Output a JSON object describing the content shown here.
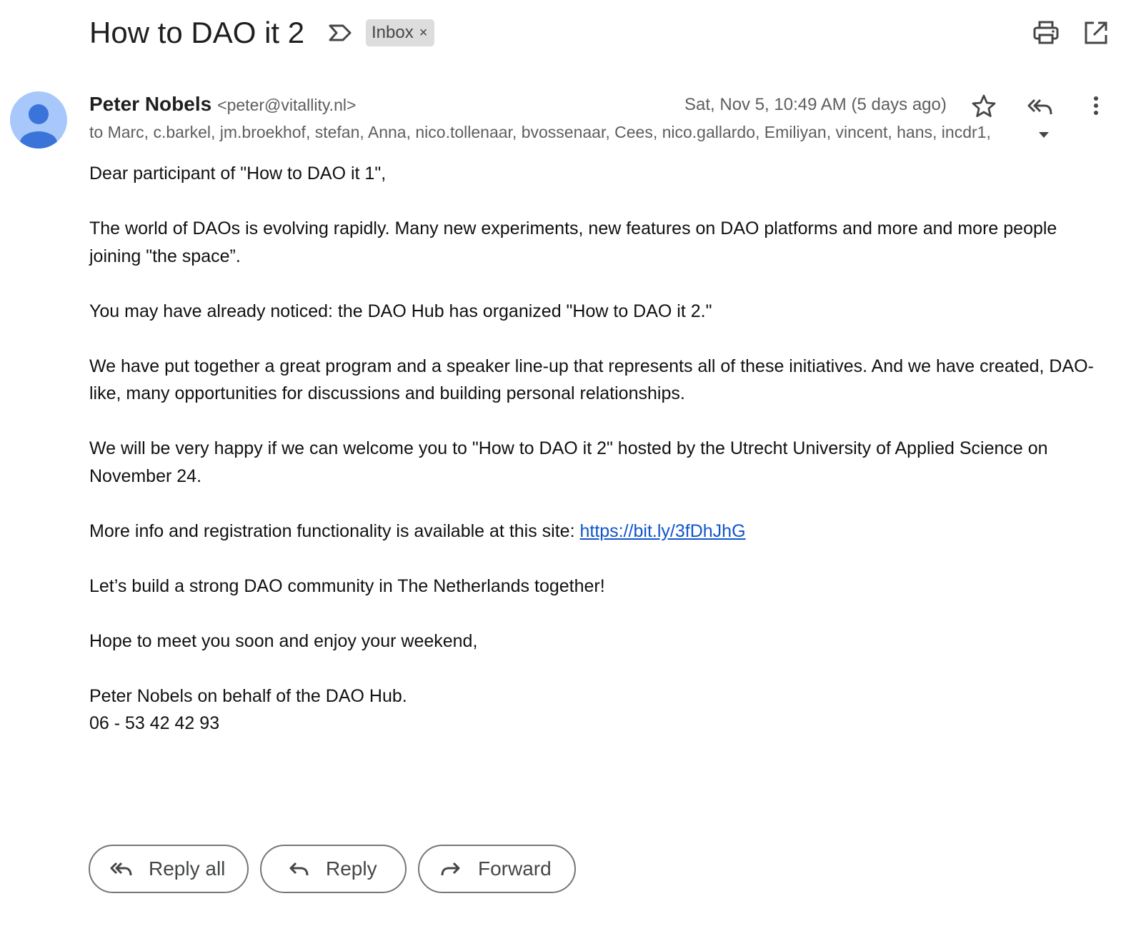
{
  "subject": "How to DAO it 2",
  "label": {
    "text": "Inbox",
    "remove_glyph": "×"
  },
  "icons": {
    "important": "important-marker-icon",
    "print": "print-icon",
    "popout": "open-in-new-window-icon",
    "star": "star-icon",
    "reply_all": "reply-all-icon",
    "more": "more-vert-icon",
    "expand_recipients": "arrow-drop-down-icon"
  },
  "sender": {
    "name": "Peter Nobels",
    "email": "<peter@vitallity.nl>",
    "date": "Sat, Nov 5, 10:49 AM (5 days ago)",
    "recipients": "to Marc, c.barkel, jm.broekhof, stefan, Anna, nico.tollenaar, bvossenaar, Cees, nico.gallardo, Emiliyan, vincent, hans, incdr1,"
  },
  "body": {
    "greeting": "Dear participant of \"How to DAO it 1\",",
    "p1": "The world of DAOs is evolving rapidly. Many new experiments, new features on DAO platforms and more and more people joining \"the space”.",
    "p2": "You may have already noticed: the DAO Hub has organized \"How to DAO it 2.\"",
    "p3": "We have put together a great program and a speaker line-up that represents all of these initiatives. And we have created, DAO-like, many opportunities for discussions and building personal relationships.",
    "p4": "We will be very happy if we can welcome you to \"How to DAO it 2\" hosted by the Utrecht University of Applied Science on November 24.",
    "p5_prefix": "More info and registration functionality is available at this site: ",
    "p5_link": "https://bit.ly/3fDhJhG",
    "p6": "Let’s build a strong DAO community in The Netherlands together!",
    "p7": "Hope to meet you soon and enjoy your weekend,",
    "signature_line1": "Peter Nobels on behalf of the DAO Hub.",
    "signature_line2": "06 - 53 42 42 93"
  },
  "actions": {
    "reply_all": "Reply all",
    "reply": "Reply",
    "forward": "Forward"
  },
  "colors": {
    "avatar_bg": "#a8c7fa",
    "avatar_fg": "#3b74d9",
    "link": "#1155cc",
    "label_chip": "#dddddd"
  }
}
